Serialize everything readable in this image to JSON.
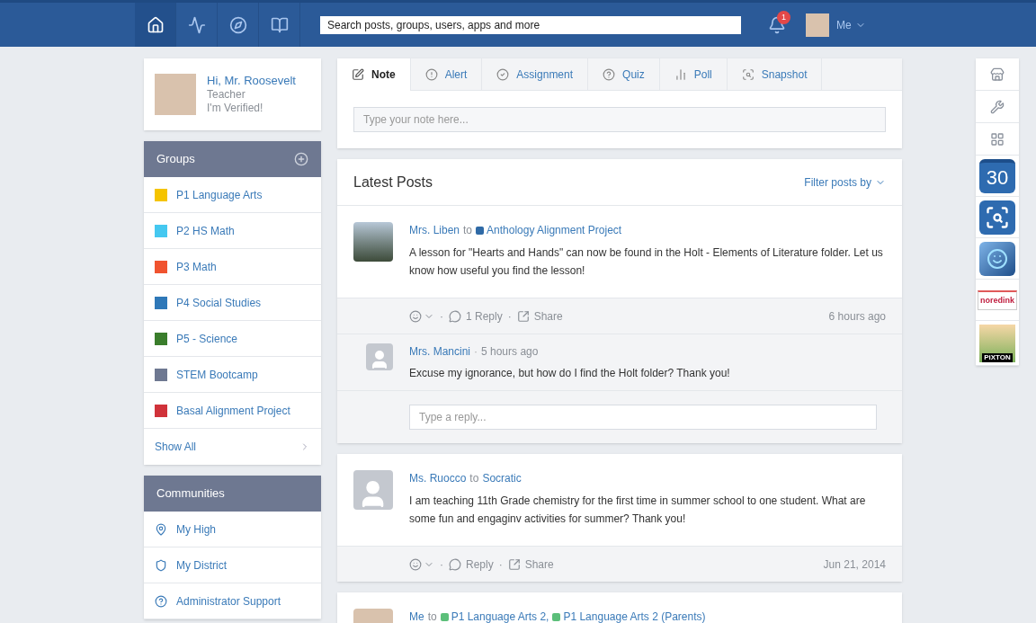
{
  "topbar": {
    "nav": [
      {
        "kind": "home",
        "selected": true
      },
      {
        "kind": "activity",
        "selected": false
      },
      {
        "kind": "discover",
        "selected": false
      },
      {
        "kind": "library",
        "selected": false
      }
    ],
    "search": {
      "placeholder": "Search posts, groups, users, apps and more"
    },
    "notifications": "1",
    "user": "Me"
  },
  "profile": {
    "greeting": "Hi, Mr. Roosevelt",
    "role": "Teacher",
    "status": "I'm Verified!"
  },
  "groups": {
    "title": "Groups",
    "items": [
      {
        "name": "P1 Language Arts",
        "color": "#f5c400"
      },
      {
        "name": "P2 HS Math",
        "color": "#45c8f0"
      },
      {
        "name": "P3 Math",
        "color": "#f0532f"
      },
      {
        "name": "P4 Social Studies",
        "color": "#2f78b8"
      },
      {
        "name": "P5 - Science",
        "color": "#3a7d2c"
      },
      {
        "name": "STEM Bootcamp",
        "color": "#6e7891"
      },
      {
        "name": "Basal Alignment Project",
        "color": "#d0323a"
      }
    ],
    "show_all": "Show All"
  },
  "communities": {
    "title": "Communities",
    "items": [
      {
        "name": "My High",
        "kind": "school"
      },
      {
        "name": "My District",
        "kind": "district"
      },
      {
        "name": "Administrator Support",
        "kind": "help"
      }
    ]
  },
  "composer": {
    "tabs": [
      {
        "label": "Note",
        "kind": "note",
        "selected": true
      },
      {
        "label": "Alert",
        "kind": "alert",
        "selected": false
      },
      {
        "label": "Assignment",
        "kind": "assignment",
        "selected": false
      },
      {
        "label": "Quiz",
        "kind": "quiz",
        "selected": false
      },
      {
        "label": "Poll",
        "kind": "poll",
        "selected": false
      },
      {
        "label": "Snapshot",
        "kind": "snapshot",
        "selected": false
      }
    ],
    "placeholder": "Type your note here..."
  },
  "feed": {
    "title": "Latest Posts",
    "filter": "Filter posts by",
    "posts": [
      {
        "author": "Mrs. Liben",
        "avatar": {
          "kind": "photo"
        },
        "joiner": "to",
        "targets": [
          {
            "name": "Anthology Alignment Project",
            "color": "#2f6aa6"
          }
        ],
        "body": "A lesson for \"Hearts and Hands\" can now be found in the Holt - Elements of Literature folder. Let us know how useful you find the lesson!",
        "separator": "·",
        "reply": "1 Reply",
        "separator_2": "·",
        "share": "Share",
        "time": "6 hours ago",
        "comments": [
          {
            "author": "Mrs. Mancini",
            "separator": "·",
            "time": "5 hours ago",
            "avatar": {
              "kind": "silhouette"
            },
            "body": "Excuse my ignorance, but how do I find the Holt folder? Thank you!"
          }
        ],
        "reply_placeholder": "Type a reply..."
      },
      {
        "author": "Ms. Ruocco",
        "avatar": {
          "kind": "silhouette"
        },
        "joiner": "to",
        "targets": [
          {
            "name": "Socratic"
          }
        ],
        "body": "I am teaching 11th Grade chemistry for the first time in summer school to one student. What are some fun and engaginv activities for summer? Thank you!",
        "separator": "·",
        "reply": "Reply",
        "separator_2": "·",
        "share": "Share",
        "time": "Jun 21, 2014"
      },
      {
        "author": "Me",
        "avatar": {
          "kind": "person"
        },
        "joiner": "to",
        "targets": [
          {
            "name": "P1 Language Arts 2,",
            "color": "#5cbf7a"
          },
          {
            "name": "P1 Language Arts 2 (Parents)",
            "color": "#5cbf7a"
          }
        ]
      }
    ]
  },
  "apps": [
    {
      "kind": "store"
    },
    {
      "kind": "tools"
    },
    {
      "kind": "grid"
    },
    {
      "kind": "calendar",
      "label": "30"
    },
    {
      "kind": "review"
    },
    {
      "kind": "game"
    },
    {
      "kind": "noredink",
      "label": "noredink"
    },
    {
      "kind": "pixton",
      "label": "PiXTON"
    }
  ]
}
